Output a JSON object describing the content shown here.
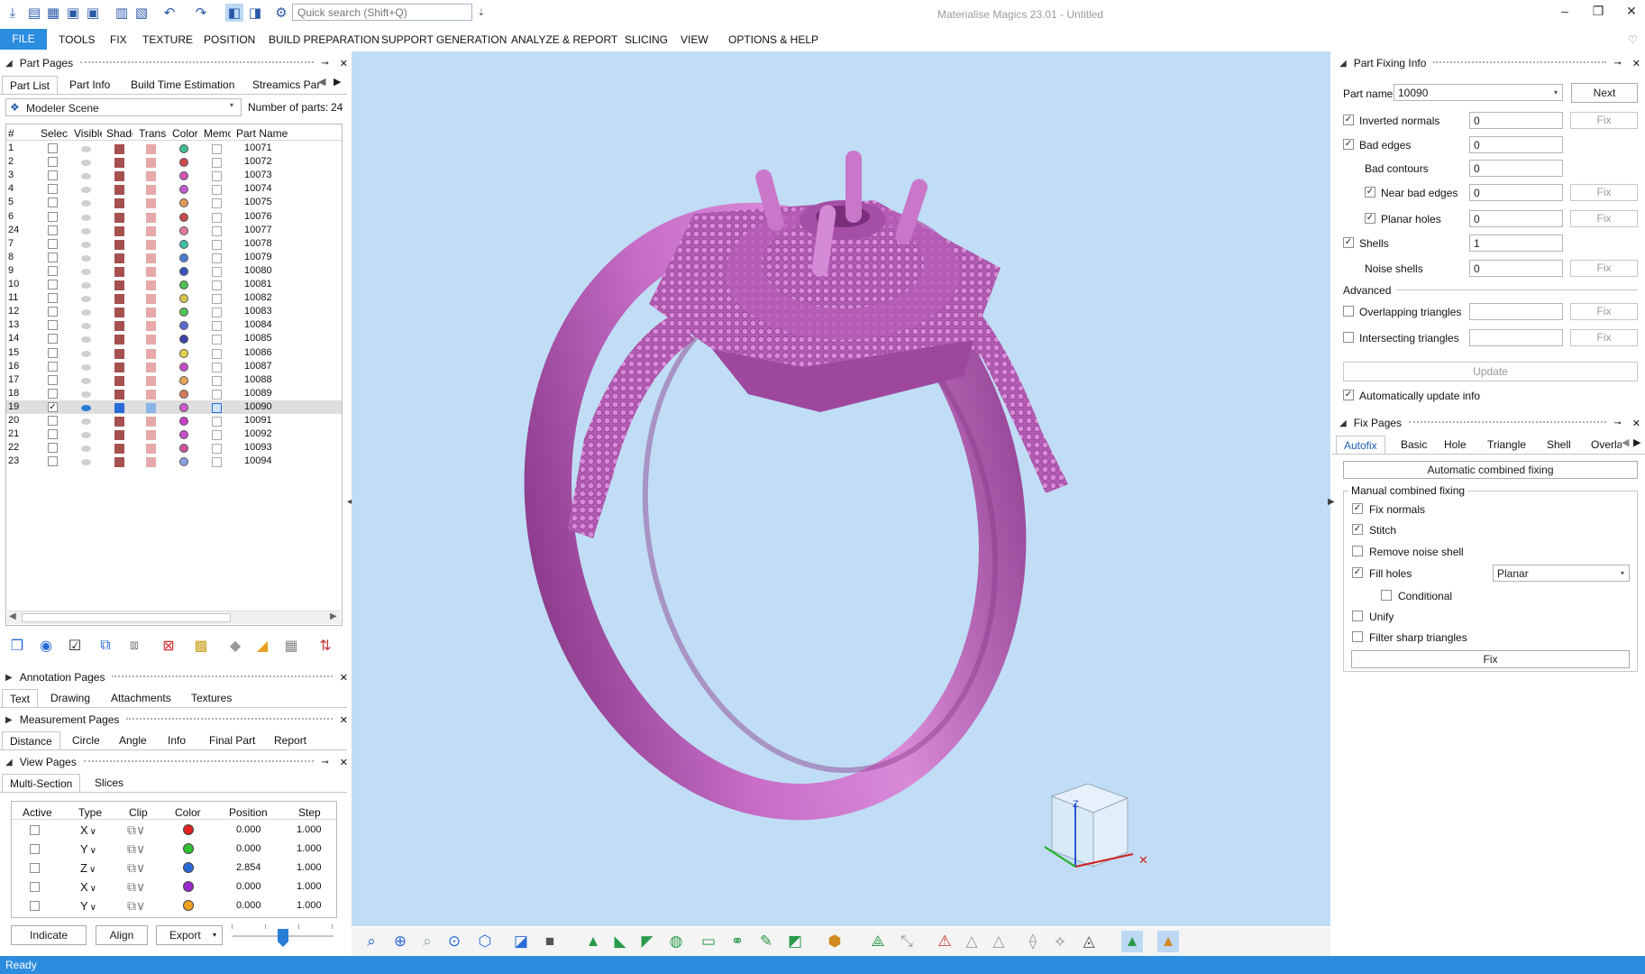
{
  "app": {
    "title": "Materialise Magics 23.01 - Untitled"
  },
  "quick_access": {
    "search_placeholder": "Quick search (Shift+Q)"
  },
  "menu": [
    "FILE",
    "TOOLS",
    "FIX",
    "TEXTURE",
    "POSITION",
    "BUILD PREPARATION",
    "SUPPORT GENERATION",
    "ANALYZE & REPORT",
    "SLICING",
    "VIEW",
    "OPTIONS & HELP"
  ],
  "part_pages": {
    "title": "Part Pages",
    "tabs": [
      "Part List",
      "Part Info",
      "Build Time Estimation",
      "Streamics Part"
    ],
    "scene": "Modeler Scene",
    "num_parts_label": "Number of parts:",
    "num_parts": "24",
    "columns": [
      "#",
      "Select",
      "Visible",
      "Shaded",
      "Trans",
      "Color",
      "Memo",
      "Part Name"
    ],
    "rows": [
      {
        "n": "1",
        "name": "10071",
        "color": "#3fbf8f"
      },
      {
        "n": "2",
        "name": "10072",
        "color": "#d04b4b"
      },
      {
        "n": "3",
        "name": "10073",
        "color": "#d452b5"
      },
      {
        "n": "4",
        "name": "10074",
        "color": "#c25fd0"
      },
      {
        "n": "5",
        "name": "10075",
        "color": "#e39a5a"
      },
      {
        "n": "6",
        "name": "10076",
        "color": "#c94a4a"
      },
      {
        "n": "24",
        "name": "10077",
        "color": "#e27a9a"
      },
      {
        "n": "7",
        "name": "10078",
        "color": "#3fbfa8"
      },
      {
        "n": "8",
        "name": "10079",
        "color": "#4a7dd0"
      },
      {
        "n": "9",
        "name": "10080",
        "color": "#3a55c0"
      },
      {
        "n": "10",
        "name": "10081",
        "color": "#4fc04f"
      },
      {
        "n": "11",
        "name": "10082",
        "color": "#d8c64a"
      },
      {
        "n": "12",
        "name": "10083",
        "color": "#52c052"
      },
      {
        "n": "13",
        "name": "10084",
        "color": "#5a6ad0"
      },
      {
        "n": "14",
        "name": "10085",
        "color": "#3b3fa8"
      },
      {
        "n": "15",
        "name": "10086",
        "color": "#e0d24a"
      },
      {
        "n": "16",
        "name": "10087",
        "color": "#c64fc6"
      },
      {
        "n": "17",
        "name": "10088",
        "color": "#e6a35a"
      },
      {
        "n": "18",
        "name": "10089",
        "color": "#d67a5a"
      },
      {
        "n": "19",
        "name": "10090",
        "color": "#d05ad0",
        "selected": true
      },
      {
        "n": "20",
        "name": "10091",
        "color": "#c840c8"
      },
      {
        "n": "21",
        "name": "10092",
        "color": "#c850c8"
      },
      {
        "n": "22",
        "name": "10093",
        "color": "#d04fa0"
      },
      {
        "n": "23",
        "name": "10094",
        "color": "#8aa0e0"
      }
    ]
  },
  "annotation_pages": {
    "title": "Annotation Pages",
    "tabs": [
      "Text",
      "Drawing",
      "Attachments",
      "Textures"
    ]
  },
  "measurement_pages": {
    "title": "Measurement Pages",
    "tabs": [
      "Distance",
      "Circle",
      "Angle",
      "Info",
      "Final Part",
      "Report"
    ]
  },
  "view_pages": {
    "title": "View Pages",
    "tabs": [
      "Multi-Section",
      "Slices"
    ],
    "columns": [
      "Active",
      "Type",
      "Clip",
      "Color",
      "Position",
      "Step"
    ],
    "rows": [
      {
        "type": "X",
        "color": "#e02020",
        "position": "0.000",
        "step": "1.000"
      },
      {
        "type": "Y",
        "color": "#30c030",
        "position": "0.000",
        "step": "1.000"
      },
      {
        "type": "Z",
        "color": "#2a6ad8",
        "position": "2.854",
        "step": "1.000"
      },
      {
        "type": "X",
        "color": "#9a28c8",
        "position": "0.000",
        "step": "1.000"
      },
      {
        "type": "Y",
        "color": "#f0a020",
        "position": "0.000",
        "step": "1.000"
      }
    ],
    "buttons": [
      "Indicate",
      "Align",
      "Export"
    ]
  },
  "part_fixing_info": {
    "title": "Part Fixing Info",
    "part_name_label": "Part name",
    "part_name": "10090",
    "next": "Next",
    "fix": "Fix",
    "rows": [
      {
        "label": "Inverted normals",
        "value": "0",
        "check": true,
        "fix": true
      },
      {
        "label": "Bad edges",
        "value": "0",
        "check": true,
        "fix": false
      },
      {
        "label": "Bad contours",
        "value": "0",
        "check": null,
        "fix": false
      },
      {
        "label": "Near bad edges",
        "value": "0",
        "check": true,
        "fix": true
      },
      {
        "label": "Planar holes",
        "value": "0",
        "check": true,
        "fix": true
      },
      {
        "label": "Shells",
        "value": "1",
        "check": true,
        "fix": false
      },
      {
        "label": "Noise shells",
        "value": "0",
        "check": null,
        "fix": true
      }
    ],
    "advanced": "Advanced",
    "adv_rows": [
      {
        "label": "Overlapping triangles",
        "value": ""
      },
      {
        "label": "Intersecting triangles",
        "value": ""
      }
    ],
    "update": "Update",
    "auto_update": "Automatically update info"
  },
  "fix_pages": {
    "title": "Fix Pages",
    "tabs": [
      "Autofix",
      "Basic",
      "Hole",
      "Triangle",
      "Shell",
      "Overla"
    ],
    "auto_combined": "Automatic combined fixing",
    "manual_title": "Manual combined fixing",
    "options": [
      {
        "label": "Fix normals",
        "checked": true
      },
      {
        "label": "Stitch",
        "checked": true
      },
      {
        "label": "Remove noise shell",
        "checked": false
      },
      {
        "label": "Fill holes",
        "checked": true
      },
      {
        "label": "Conditional",
        "checked": false
      },
      {
        "label": "Unify",
        "checked": false
      },
      {
        "label": "Filter sharp triangles",
        "checked": false
      }
    ],
    "fill_mode": "Planar",
    "fix": "Fix"
  },
  "status": {
    "text": "Ready"
  },
  "colors": {
    "accent": "#2b8de0",
    "viewport": "#c0ddf5",
    "model": "#c86ec8"
  }
}
